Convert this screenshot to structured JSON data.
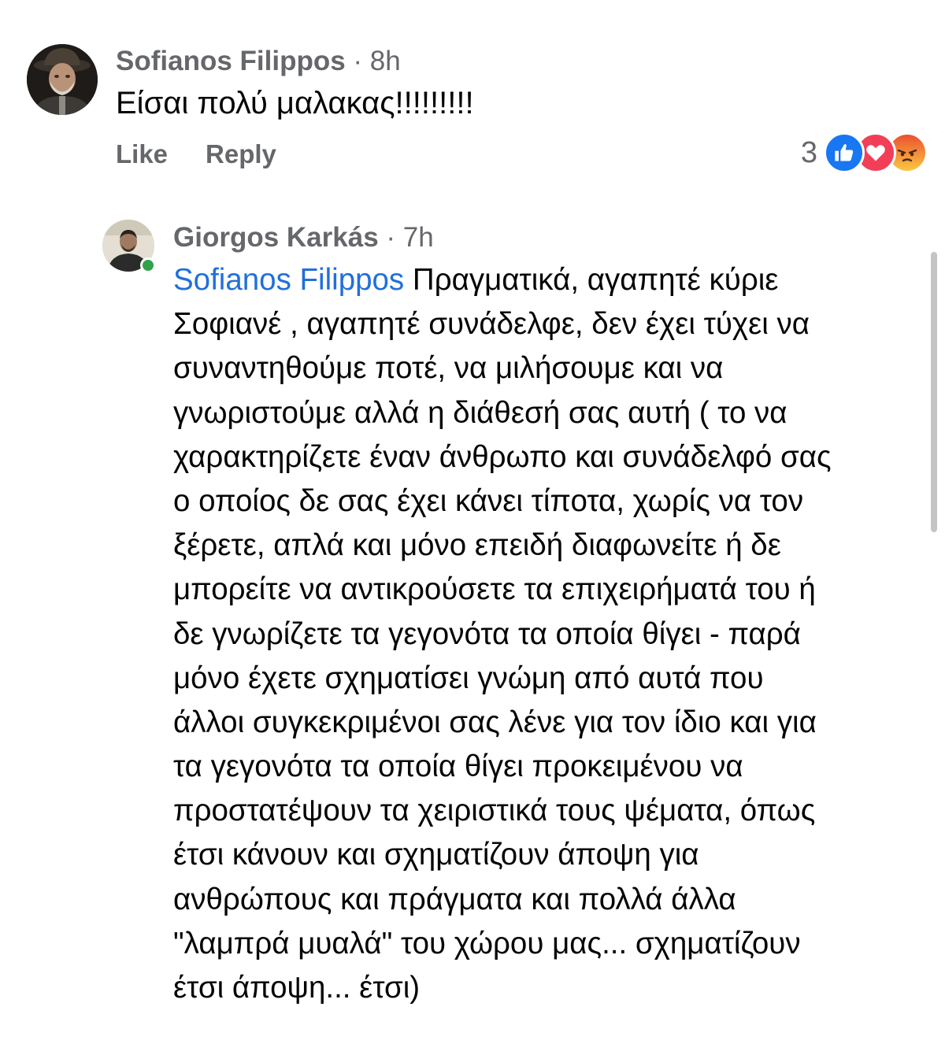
{
  "top_comment": {
    "author": "Sofianos Filippos",
    "time": "· 8h",
    "text": "Είσαι πολύ μαλακας!!!!!!!!!",
    "actions": {
      "like": "Like",
      "reply": "Reply"
    },
    "reactions": {
      "count": "3",
      "types": [
        "like-icon",
        "love-icon",
        "angry-icon"
      ]
    }
  },
  "reply_comment": {
    "author": "Giorgos Karkás",
    "time": "· 7h",
    "mention": "Sofianos Filippos",
    "lines": [
      "Πραγματικά, αγαπητέ κύριε",
      "Σοφιανέ , αγαπητέ συνάδελφε, δεν έχει τύχει να",
      "συναντηθούμε ποτέ, να μιλήσουμε και να",
      "γνωριστούμε αλλά η διάθεσή σας αυτή ( το να",
      "χαρακτηρίζετε έναν άνθρωπο και συνάδελφό σας",
      "ο οποίος δε σας έχει κάνει τίποτα, χωρίς να τον",
      "ξέρετε, απλά και μόνο επειδή διαφωνείτε ή δε",
      "μπορείτε να αντικρούσετε τα επιχειρήματά του ή",
      "δε γνωρίζετε τα γεγονότα τα οποία θίγει - παρά",
      "μόνο έχετε σχηματίσει γνώμη από αυτά που",
      "άλλοι συγκεκριμένοι σας λένε για τον ίδιο και για",
      "τα γεγονότα τα οποία θίγει προκειμένου να",
      "προστατέψουν τα χειριστικά τους ψέματα, όπως",
      "έτσι κάνουν και σχηματίζουν άποψη για",
      "ανθρώπους και πράγματα και πολλά άλλα",
      "\"λαμπρά μυαλά\" του χώρου μας... σχηματίζουν",
      "έτσι άποψη... έτσι)"
    ],
    "online": true
  },
  "colors": {
    "meta_gray": "#65676b",
    "text": "#050505",
    "mention_blue": "#216fdb",
    "like_blue": "#1877f2",
    "love_red": "#f33e58",
    "online_green": "#31a24c"
  }
}
